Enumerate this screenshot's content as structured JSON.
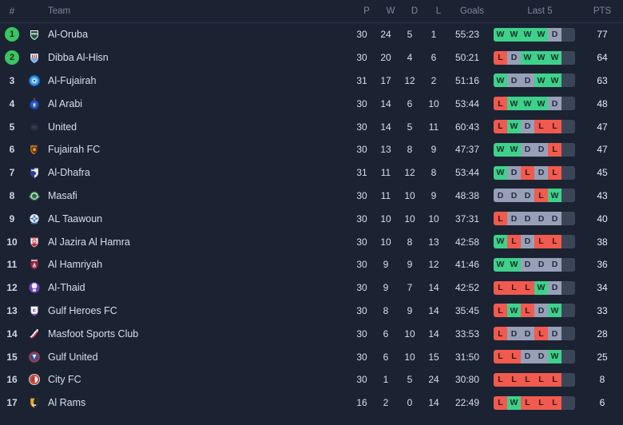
{
  "header": {
    "rank": "#",
    "team": "Team",
    "p": "P",
    "w": "W",
    "d": "D",
    "l": "L",
    "goals": "Goals",
    "last5": "Last 5",
    "pts": "PTS"
  },
  "colors": {
    "background": "#1b2333",
    "row_text": "#d7dfeb",
    "header_text": "#7b8699",
    "promotion_badge": "#3cc462",
    "win": "#3fd18b",
    "draw": "#98a0b8",
    "loss": "#f05a4f",
    "form_track": "#3b4558",
    "divider": "#2b344a"
  },
  "chart_data": {
    "type": "table",
    "title": "League Standings",
    "columns": [
      "#",
      "Team",
      "P",
      "W",
      "D",
      "L",
      "Goals",
      "Last 5",
      "PTS"
    ],
    "rows": [
      {
        "rank": "1",
        "team": "Al-Oruba",
        "p": "30",
        "w": "24",
        "d": "5",
        "l": "1",
        "goals": "55:23",
        "form": [
          "W",
          "W",
          "W",
          "W",
          "D"
        ],
        "pts": "77",
        "highlight": true,
        "crest": "crest-al-oruba"
      },
      {
        "rank": "2",
        "team": "Dibba Al-Hisn",
        "p": "30",
        "w": "20",
        "d": "4",
        "l": "6",
        "goals": "50:21",
        "form": [
          "L",
          "D",
          "W",
          "W",
          "W"
        ],
        "pts": "64",
        "highlight": true,
        "crest": "crest-dibba-al-hisn"
      },
      {
        "rank": "3",
        "team": "Al-Fujairah",
        "p": "31",
        "w": "17",
        "d": "12",
        "l": "2",
        "goals": "51:16",
        "form": [
          "W",
          "D",
          "D",
          "W",
          "W"
        ],
        "pts": "63",
        "highlight": false,
        "crest": "crest-al-fujairah"
      },
      {
        "rank": "4",
        "team": "Al Arabi",
        "p": "30",
        "w": "14",
        "d": "6",
        "l": "10",
        "goals": "53:44",
        "form": [
          "L",
          "W",
          "W",
          "W",
          "D"
        ],
        "pts": "48",
        "highlight": false,
        "crest": "crest-al-arabi"
      },
      {
        "rank": "5",
        "team": "United",
        "p": "30",
        "w": "14",
        "d": "5",
        "l": "11",
        "goals": "60:43",
        "form": [
          "L",
          "W",
          "D",
          "L",
          "L"
        ],
        "pts": "47",
        "highlight": false,
        "crest": "crest-united"
      },
      {
        "rank": "6",
        "team": "Fujairah FC",
        "p": "30",
        "w": "13",
        "d": "8",
        "l": "9",
        "goals": "47:37",
        "form": [
          "W",
          "W",
          "D",
          "D",
          "L"
        ],
        "pts": "47",
        "highlight": false,
        "crest": "crest-fujairah-fc"
      },
      {
        "rank": "7",
        "team": "Al-Dhafra",
        "p": "31",
        "w": "11",
        "d": "12",
        "l": "8",
        "goals": "53:44",
        "form": [
          "W",
          "D",
          "L",
          "D",
          "L"
        ],
        "pts": "45",
        "highlight": false,
        "crest": "crest-al-dhafra"
      },
      {
        "rank": "8",
        "team": "Masafi",
        "p": "30",
        "w": "11",
        "d": "10",
        "l": "9",
        "goals": "48:38",
        "form": [
          "D",
          "D",
          "D",
          "L",
          "W"
        ],
        "pts": "43",
        "highlight": false,
        "crest": "crest-masafi"
      },
      {
        "rank": "9",
        "team": "AL Taawoun",
        "p": "30",
        "w": "10",
        "d": "10",
        "l": "10",
        "goals": "37:31",
        "form": [
          "L",
          "D",
          "D",
          "D",
          "D"
        ],
        "pts": "40",
        "highlight": false,
        "crest": "crest-al-taawoun"
      },
      {
        "rank": "10",
        "team": "Al Jazira Al Hamra",
        "p": "30",
        "w": "10",
        "d": "8",
        "l": "13",
        "goals": "42:58",
        "form": [
          "W",
          "L",
          "D",
          "L",
          "L"
        ],
        "pts": "38",
        "highlight": false,
        "crest": "crest-al-jazira-al-hamra"
      },
      {
        "rank": "11",
        "team": "Al Hamriyah",
        "p": "30",
        "w": "9",
        "d": "9",
        "l": "12",
        "goals": "41:46",
        "form": [
          "W",
          "W",
          "D",
          "D",
          "D"
        ],
        "pts": "36",
        "highlight": false,
        "crest": "crest-al-hamriyah"
      },
      {
        "rank": "12",
        "team": "Al-Thaid",
        "p": "30",
        "w": "9",
        "d": "7",
        "l": "14",
        "goals": "42:52",
        "form": [
          "L",
          "L",
          "L",
          "W",
          "D"
        ],
        "pts": "34",
        "highlight": false,
        "crest": "crest-al-thaid"
      },
      {
        "rank": "13",
        "team": "Gulf Heroes FC",
        "p": "30",
        "w": "8",
        "d": "9",
        "l": "14",
        "goals": "35:45",
        "form": [
          "L",
          "W",
          "L",
          "D",
          "W"
        ],
        "pts": "33",
        "highlight": false,
        "crest": "crest-gulf-heroes-fc"
      },
      {
        "rank": "14",
        "team": "Masfoot Sports Club",
        "p": "30",
        "w": "6",
        "d": "10",
        "l": "14",
        "goals": "33:53",
        "form": [
          "L",
          "D",
          "D",
          "L",
          "D"
        ],
        "pts": "28",
        "highlight": false,
        "crest": "crest-masfoot"
      },
      {
        "rank": "15",
        "team": "Gulf United",
        "p": "30",
        "w": "6",
        "d": "10",
        "l": "15",
        "goals": "31:50",
        "form": [
          "L",
          "L",
          "D",
          "D",
          "W"
        ],
        "pts": "25",
        "highlight": false,
        "crest": "crest-gulf-united"
      },
      {
        "rank": "16",
        "team": "City FC",
        "p": "30",
        "w": "1",
        "d": "5",
        "l": "24",
        "goals": "30:80",
        "form": [
          "L",
          "L",
          "L",
          "L",
          "L"
        ],
        "pts": "8",
        "highlight": false,
        "crest": "crest-city-fc"
      },
      {
        "rank": "17",
        "team": "Al Rams",
        "p": "16",
        "w": "2",
        "d": "0",
        "l": "14",
        "goals": "22:49",
        "form": [
          "L",
          "W",
          "L",
          "L",
          "L"
        ],
        "pts": "6",
        "highlight": false,
        "crest": "crest-al-rams"
      }
    ]
  }
}
